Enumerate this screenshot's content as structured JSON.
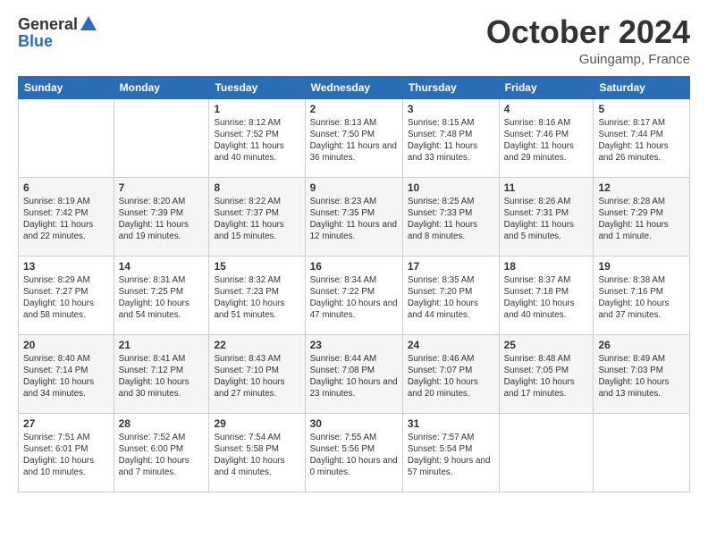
{
  "header": {
    "logo_general": "General",
    "logo_blue": "Blue",
    "month_title": "October 2024",
    "location": "Guingamp, France"
  },
  "calendar": {
    "days_of_week": [
      "Sunday",
      "Monday",
      "Tuesday",
      "Wednesday",
      "Thursday",
      "Friday",
      "Saturday"
    ],
    "weeks": [
      [
        {
          "day": "",
          "sunrise": "",
          "sunset": "",
          "daylight": ""
        },
        {
          "day": "",
          "sunrise": "",
          "sunset": "",
          "daylight": ""
        },
        {
          "day": "1",
          "sunrise": "Sunrise: 8:12 AM",
          "sunset": "Sunset: 7:52 PM",
          "daylight": "Daylight: 11 hours and 40 minutes."
        },
        {
          "day": "2",
          "sunrise": "Sunrise: 8:13 AM",
          "sunset": "Sunset: 7:50 PM",
          "daylight": "Daylight: 11 hours and 36 minutes."
        },
        {
          "day": "3",
          "sunrise": "Sunrise: 8:15 AM",
          "sunset": "Sunset: 7:48 PM",
          "daylight": "Daylight: 11 hours and 33 minutes."
        },
        {
          "day": "4",
          "sunrise": "Sunrise: 8:16 AM",
          "sunset": "Sunset: 7:46 PM",
          "daylight": "Daylight: 11 hours and 29 minutes."
        },
        {
          "day": "5",
          "sunrise": "Sunrise: 8:17 AM",
          "sunset": "Sunset: 7:44 PM",
          "daylight": "Daylight: 11 hours and 26 minutes."
        }
      ],
      [
        {
          "day": "6",
          "sunrise": "Sunrise: 8:19 AM",
          "sunset": "Sunset: 7:42 PM",
          "daylight": "Daylight: 11 hours and 22 minutes."
        },
        {
          "day": "7",
          "sunrise": "Sunrise: 8:20 AM",
          "sunset": "Sunset: 7:39 PM",
          "daylight": "Daylight: 11 hours and 19 minutes."
        },
        {
          "day": "8",
          "sunrise": "Sunrise: 8:22 AM",
          "sunset": "Sunset: 7:37 PM",
          "daylight": "Daylight: 11 hours and 15 minutes."
        },
        {
          "day": "9",
          "sunrise": "Sunrise: 8:23 AM",
          "sunset": "Sunset: 7:35 PM",
          "daylight": "Daylight: 11 hours and 12 minutes."
        },
        {
          "day": "10",
          "sunrise": "Sunrise: 8:25 AM",
          "sunset": "Sunset: 7:33 PM",
          "daylight": "Daylight: 11 hours and 8 minutes."
        },
        {
          "day": "11",
          "sunrise": "Sunrise: 8:26 AM",
          "sunset": "Sunset: 7:31 PM",
          "daylight": "Daylight: 11 hours and 5 minutes."
        },
        {
          "day": "12",
          "sunrise": "Sunrise: 8:28 AM",
          "sunset": "Sunset: 7:29 PM",
          "daylight": "Daylight: 11 hours and 1 minute."
        }
      ],
      [
        {
          "day": "13",
          "sunrise": "Sunrise: 8:29 AM",
          "sunset": "Sunset: 7:27 PM",
          "daylight": "Daylight: 10 hours and 58 minutes."
        },
        {
          "day": "14",
          "sunrise": "Sunrise: 8:31 AM",
          "sunset": "Sunset: 7:25 PM",
          "daylight": "Daylight: 10 hours and 54 minutes."
        },
        {
          "day": "15",
          "sunrise": "Sunrise: 8:32 AM",
          "sunset": "Sunset: 7:23 PM",
          "daylight": "Daylight: 10 hours and 51 minutes."
        },
        {
          "day": "16",
          "sunrise": "Sunrise: 8:34 AM",
          "sunset": "Sunset: 7:22 PM",
          "daylight": "Daylight: 10 hours and 47 minutes."
        },
        {
          "day": "17",
          "sunrise": "Sunrise: 8:35 AM",
          "sunset": "Sunset: 7:20 PM",
          "daylight": "Daylight: 10 hours and 44 minutes."
        },
        {
          "day": "18",
          "sunrise": "Sunrise: 8:37 AM",
          "sunset": "Sunset: 7:18 PM",
          "daylight": "Daylight: 10 hours and 40 minutes."
        },
        {
          "day": "19",
          "sunrise": "Sunrise: 8:38 AM",
          "sunset": "Sunset: 7:16 PM",
          "daylight": "Daylight: 10 hours and 37 minutes."
        }
      ],
      [
        {
          "day": "20",
          "sunrise": "Sunrise: 8:40 AM",
          "sunset": "Sunset: 7:14 PM",
          "daylight": "Daylight: 10 hours and 34 minutes."
        },
        {
          "day": "21",
          "sunrise": "Sunrise: 8:41 AM",
          "sunset": "Sunset: 7:12 PM",
          "daylight": "Daylight: 10 hours and 30 minutes."
        },
        {
          "day": "22",
          "sunrise": "Sunrise: 8:43 AM",
          "sunset": "Sunset: 7:10 PM",
          "daylight": "Daylight: 10 hours and 27 minutes."
        },
        {
          "day": "23",
          "sunrise": "Sunrise: 8:44 AM",
          "sunset": "Sunset: 7:08 PM",
          "daylight": "Daylight: 10 hours and 23 minutes."
        },
        {
          "day": "24",
          "sunrise": "Sunrise: 8:46 AM",
          "sunset": "Sunset: 7:07 PM",
          "daylight": "Daylight: 10 hours and 20 minutes."
        },
        {
          "day": "25",
          "sunrise": "Sunrise: 8:48 AM",
          "sunset": "Sunset: 7:05 PM",
          "daylight": "Daylight: 10 hours and 17 minutes."
        },
        {
          "day": "26",
          "sunrise": "Sunrise: 8:49 AM",
          "sunset": "Sunset: 7:03 PM",
          "daylight": "Daylight: 10 hours and 13 minutes."
        }
      ],
      [
        {
          "day": "27",
          "sunrise": "Sunrise: 7:51 AM",
          "sunset": "Sunset: 6:01 PM",
          "daylight": "Daylight: 10 hours and 10 minutes."
        },
        {
          "day": "28",
          "sunrise": "Sunrise: 7:52 AM",
          "sunset": "Sunset: 6:00 PM",
          "daylight": "Daylight: 10 hours and 7 minutes."
        },
        {
          "day": "29",
          "sunrise": "Sunrise: 7:54 AM",
          "sunset": "Sunset: 5:58 PM",
          "daylight": "Daylight: 10 hours and 4 minutes."
        },
        {
          "day": "30",
          "sunrise": "Sunrise: 7:55 AM",
          "sunset": "Sunset: 5:56 PM",
          "daylight": "Daylight: 10 hours and 0 minutes."
        },
        {
          "day": "31",
          "sunrise": "Sunrise: 7:57 AM",
          "sunset": "Sunset: 5:54 PM",
          "daylight": "Daylight: 9 hours and 57 minutes."
        },
        {
          "day": "",
          "sunrise": "",
          "sunset": "",
          "daylight": ""
        },
        {
          "day": "",
          "sunrise": "",
          "sunset": "",
          "daylight": ""
        }
      ]
    ]
  }
}
